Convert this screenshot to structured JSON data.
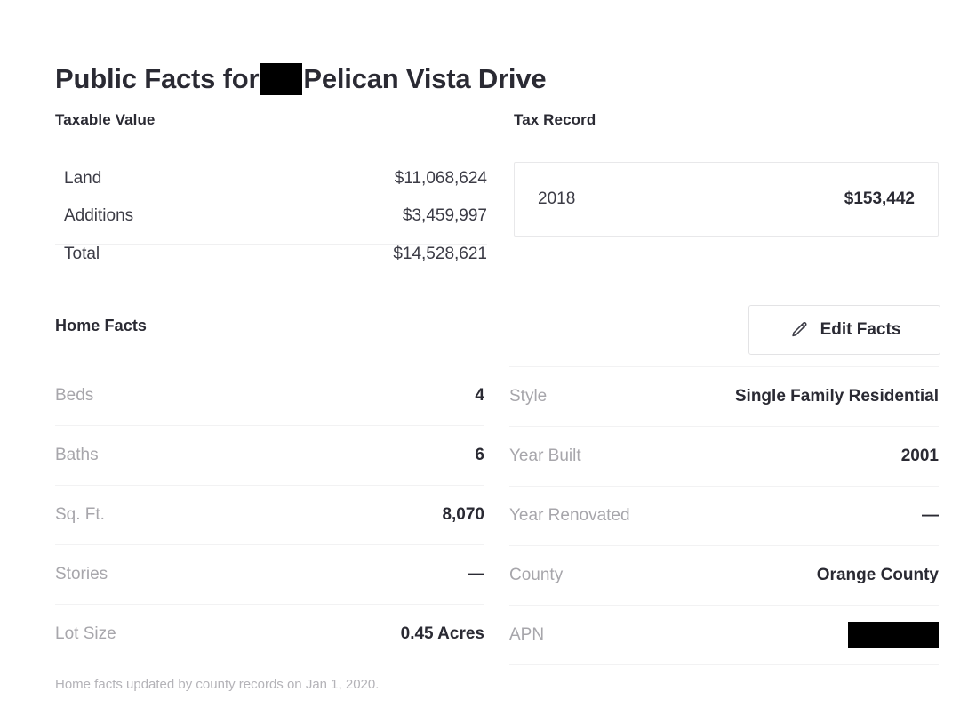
{
  "title": {
    "prefix": "Public Facts for ",
    "redacted": true,
    "suffix": "Pelican Vista Drive"
  },
  "taxable_value": {
    "heading": "Taxable Value",
    "rows": [
      {
        "label": "Land",
        "value": "$11,068,624",
        "divider_above": false
      },
      {
        "label": "Additions",
        "value": "$3,459,997",
        "divider_above": false
      },
      {
        "label": "Total",
        "value": "$14,528,621",
        "divider_above": true
      }
    ]
  },
  "tax_record": {
    "heading": "Tax Record",
    "year": "2018",
    "amount": "$153,442"
  },
  "home_facts": {
    "heading": "Home Facts",
    "edit_button": {
      "label": "Edit Facts",
      "icon": "pencil-icon"
    },
    "left_rows": [
      {
        "label": "Beds",
        "value": "4"
      },
      {
        "label": "Baths",
        "value": "6"
      },
      {
        "label": "Sq. Ft.",
        "value": "8,070"
      },
      {
        "label": "Stories",
        "value": "—"
      },
      {
        "label": "Lot Size",
        "value": "0.45 Acres"
      }
    ],
    "right_rows": [
      {
        "label": "Style",
        "value": "Single Family Residential",
        "redacted": false
      },
      {
        "label": "Year Built",
        "value": "2001",
        "redacted": false
      },
      {
        "label": "Year Renovated",
        "value": "—",
        "redacted": false
      },
      {
        "label": "County",
        "value": "Orange County",
        "redacted": false
      },
      {
        "label": "APN",
        "value": "",
        "redacted": true
      }
    ]
  },
  "footer": {
    "note": "Home facts updated by county records on Jan 1, 2020."
  },
  "colors": {
    "background": "#ffffff",
    "text_primary": "#2a2a33",
    "text_secondary": "#3b3b45",
    "label_muted": "#a7a6ab",
    "divider": "#f2f2f3",
    "border": "#e8e8ea",
    "redaction": "#000000"
  }
}
